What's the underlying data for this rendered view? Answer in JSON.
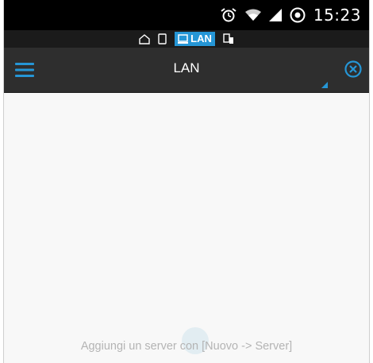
{
  "status_bar": {
    "time": "15:23",
    "icons": [
      "alarm-icon",
      "wifi-icon",
      "signal-icon",
      "battery-icon"
    ]
  },
  "mode_bar": {
    "items": [
      "home-icon",
      "phone-icon",
      "lan-icon",
      "devices-icon"
    ],
    "active_label": "LAN"
  },
  "app_bar": {
    "title": "LAN",
    "menu_icon": "hamburger-menu-icon",
    "close_icon": "close-circle-icon"
  },
  "content": {
    "empty_hint": "Aggiungi un server con [Nuovo -> Server]"
  },
  "colors": {
    "accent": "#2596d6",
    "app_bar": "#2e2e2e",
    "status_bar": "#000000",
    "background": "#f8f8f8",
    "hint_text": "#b4b4b4"
  }
}
